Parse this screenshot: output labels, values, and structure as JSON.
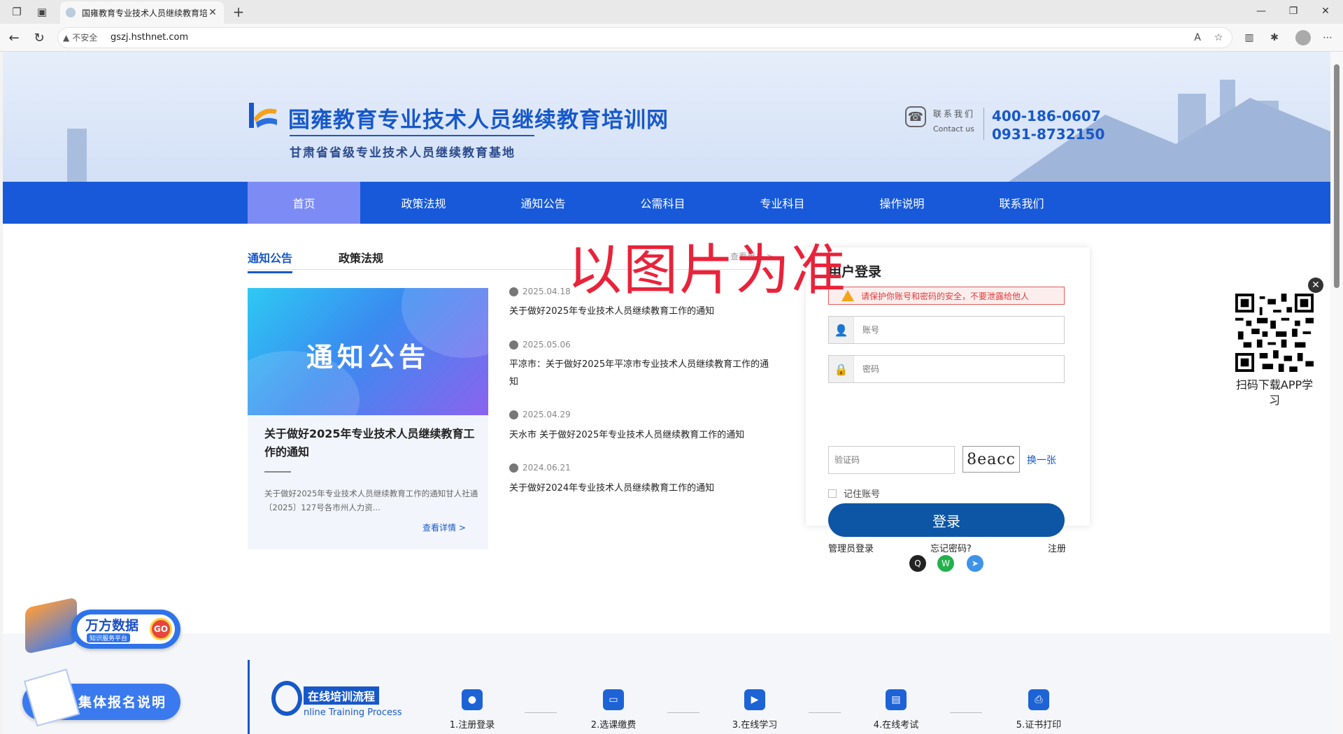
{
  "browser": {
    "tab_title": "国雍教育专业技术人员继续教育培",
    "security_label": "不安全",
    "url": "gszj.hsthnet.com"
  },
  "header": {
    "site_title": "国雍教育专业技术人员继续教育培训网",
    "site_subtitle": "甘肃省省级专业技术人员继续教育基地",
    "contact_cn": "联系我们",
    "contact_en": "Contact us",
    "phone1": "400-186-0607",
    "phone2": "0931-8732150"
  },
  "nav": {
    "items": [
      {
        "label": "首页"
      },
      {
        "label": "政策法规"
      },
      {
        "label": "通知公告"
      },
      {
        "label": "公需科目"
      },
      {
        "label": "专业科目"
      },
      {
        "label": "操作说明"
      },
      {
        "label": "联系我们"
      }
    ]
  },
  "news": {
    "tab_notice": "通知公告",
    "tab_policy": "政策法规",
    "more": "查看更多 >",
    "card_image_text": "通知公告",
    "card_title": "关于做好2025年专业技术人员继续教育工作的通知",
    "card_desc": "关于做好2025年专业技术人员继续教育工作的通知甘人社通〔2025〕127号各市州人力资...",
    "card_more": "查看详情  >",
    "items": [
      {
        "date": "2025.04.18",
        "title": "关于做好2025年专业技术人员继续教育工作的通知"
      },
      {
        "date": "2025.05.06",
        "title": "平凉市：关于做好2025年平凉市专业技术人员继续教育工作的通知"
      },
      {
        "date": "2025.04.29",
        "title": "天水市 关于做好2025年专业技术人员继续教育工作的通知"
      },
      {
        "date": "2024.06.21",
        "title": "关于做好2024年专业技术人员继续教育工作的通知"
      }
    ]
  },
  "watermark": "以图片为准",
  "login": {
    "title": "用户登录",
    "warning": "请保护你账号和密码的安全，不要泄露给他人",
    "account_placeholder": "账号",
    "password_placeholder": "密码",
    "captcha_placeholder": "验证码",
    "captcha_code": "8eacc",
    "captcha_change": "换一张",
    "remember": "记住账号",
    "submit": "登录",
    "admin_login": "管理员登录",
    "forgot": "忘记密码?",
    "register": "注册"
  },
  "qr": {
    "caption": "扫码下载APP学习"
  },
  "floats": {
    "wanfang_title": "万方数据",
    "wanfang_sub": "知识服务平台",
    "wanfang_go": "GO",
    "group_signup": "集体报名说明"
  },
  "flow": {
    "title_cn": "在线培训流程",
    "title_en": "nline Training Process",
    "steps": [
      {
        "label": "1.注册登录",
        "icon": "user-icon"
      },
      {
        "label": "2.选课缴费",
        "icon": "ticket-icon"
      },
      {
        "label": "3.在线学习",
        "icon": "video-icon"
      },
      {
        "label": "4.在线考试",
        "icon": "document-icon"
      },
      {
        "label": "5.证书打印",
        "icon": "printer-icon"
      }
    ]
  }
}
